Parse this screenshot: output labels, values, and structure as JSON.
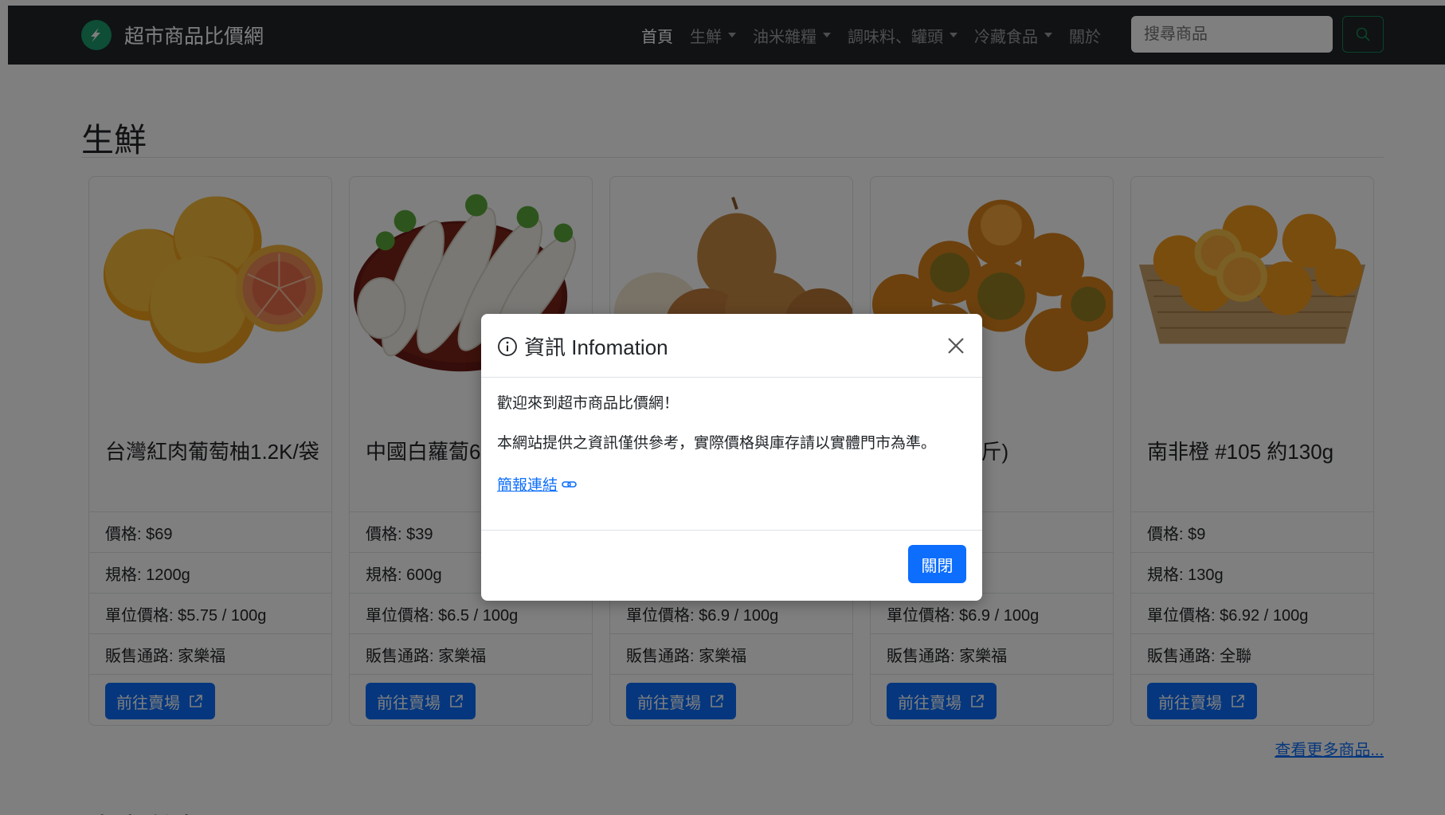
{
  "navbar": {
    "brand": "超市商品比價網",
    "items": [
      {
        "label": "首頁",
        "active": true,
        "dropdown": false
      },
      {
        "label": "生鮮",
        "active": false,
        "dropdown": true
      },
      {
        "label": "油米雜糧",
        "active": false,
        "dropdown": true
      },
      {
        "label": "調味料、罐頭",
        "active": false,
        "dropdown": true
      },
      {
        "label": "冷藏食品",
        "active": false,
        "dropdown": true
      },
      {
        "label": "關於",
        "active": false,
        "dropdown": false
      }
    ],
    "search_placeholder": "搜尋商品"
  },
  "section": {
    "title": "生鮮",
    "more_link": "查看更多商品..."
  },
  "products": [
    {
      "name": "台灣紅肉葡萄柚1.2K/袋",
      "price": "價格: $69",
      "spec": "規格: 1200g",
      "unit_price": "單位價格: $5.75 / 100g",
      "channel": "販售通路: 家樂福",
      "button": "前往賣場"
    },
    {
      "name": "中國白蘿蔔600g",
      "price": "價格: $39",
      "spec": "規格: 600g",
      "unit_price": "單位價格: $6.5 / 100g",
      "channel": "販售通路: 家樂福",
      "button": "前往賣場"
    },
    {
      "name": "",
      "price": "",
      "spec": "",
      "unit_price": "單位價格: $6.9 / 100g",
      "channel": "販售通路: 家樂福",
      "button": "前往賣場"
    },
    {
      "name": "每袋約1公斤)",
      "price": "",
      "spec": "",
      "unit_price": "單位價格: $6.9 / 100g",
      "channel": "販售通路: 家樂福",
      "button": "前往賣場"
    },
    {
      "name": "南非橙 #105 約130g",
      "price": "價格: $9",
      "spec": "規格: 130g",
      "unit_price": "單位價格: $6.92 / 100g",
      "channel": "販售通路: 全聯",
      "button": "前往賣場"
    }
  ],
  "next_section": {
    "title": "油米雜糧"
  },
  "modal": {
    "title": "資訊 Infomation",
    "welcome": "歡迎來到超市商品比價網！",
    "disclaimer": "本網站提供之資訊僅供參考，實際價格與庫存請以實體門市為準。",
    "link_text": "簡報連結",
    "close_button": "關閉"
  }
}
